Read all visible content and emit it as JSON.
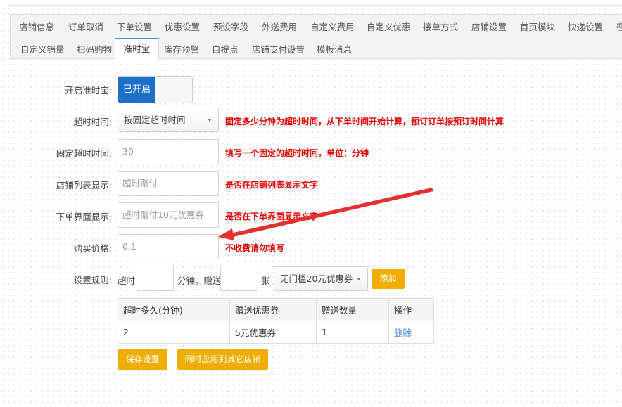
{
  "tabs_row1": [
    "店铺信息",
    "订单取消",
    "下单设置",
    "优惠设置",
    "预设字段",
    "外送费用",
    "自定义费用",
    "自定义优惠",
    "接单方式",
    "店铺设置",
    "首页模块",
    "快递设置",
    "密"
  ],
  "tabs_row2": [
    "自定义销量",
    "扫码购物",
    "准时宝",
    "库存预警",
    "自提点",
    "店铺支付设置",
    "模板消息"
  ],
  "form": {
    "enable_label": "开启准时宝:",
    "enable_state": "已开启",
    "timeout_label": "超时时间:",
    "timeout_select": "按固定超时时间",
    "timeout_hint": "固定多少分钟为超时时间，从下单时间开始计算，预订订单按预订时间计算",
    "fixed_label": "固定超时时间:",
    "fixed_value": "30",
    "fixed_hint": "填写一个固定的超时时间，单位：分钟",
    "list_label": "店铺列表显示:",
    "list_placeholder": "超时赔付",
    "list_hint": "是否在店铺列表显示文字",
    "order_label": "下单界面显示:",
    "order_placeholder": "超时赔付10元优惠券",
    "order_hint": "是否在下单界面显示文字",
    "price_label": "购买价格:",
    "price_placeholder": "0.1",
    "price_hint": "不收费请勿填写",
    "rule_label": "设置规则:",
    "rule_timeout": "超时",
    "rule_minutes": "分钟，赠送",
    "rule_unit": "张",
    "rule_coupon_select": "无门槛20元优惠券",
    "add_button": "添加"
  },
  "table": {
    "headers": [
      "超时多久(分钟)",
      "赠送优惠券",
      "赠送数量",
      "操作"
    ],
    "rows": [
      {
        "minutes": "2",
        "coupon": "5元优惠券",
        "quantity": "1",
        "action": "删除"
      }
    ]
  },
  "buttons": {
    "save": "保存设置",
    "apply_all": "同时应用到其它店铺"
  },
  "colors": {
    "accent": "#f0ad00",
    "toggle_on": "#1e6fc8",
    "hint": "#e00000",
    "arrow": "#e53030",
    "tab_active_border": "#4a90d9"
  }
}
